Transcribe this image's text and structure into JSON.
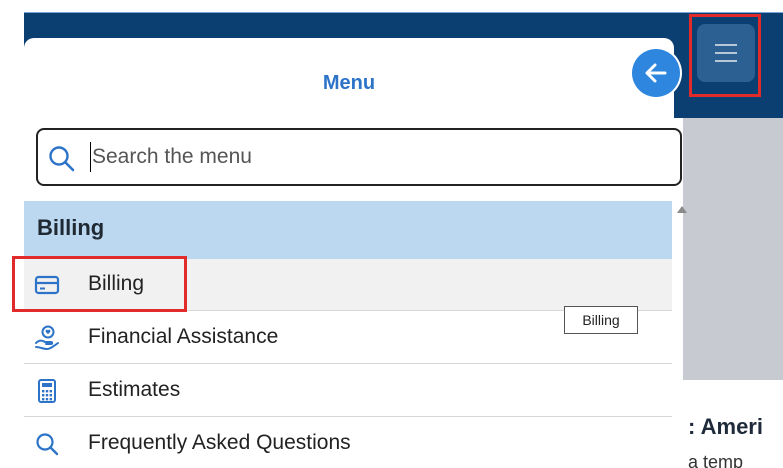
{
  "menu": {
    "title": "Menu",
    "search_placeholder": "Search the menu",
    "section_title": "Billing",
    "items": [
      {
        "label": "Billing",
        "icon": "credit-card-icon",
        "selected": true
      },
      {
        "label": "Financial Assistance",
        "icon": "hand-heart-icon",
        "selected": false
      },
      {
        "label": "Estimates",
        "icon": "calculator-icon",
        "selected": false
      },
      {
        "label": "Frequently Asked Questions",
        "icon": "search-icon",
        "selected": false
      }
    ]
  },
  "tooltip": {
    "text": "Billing"
  },
  "background": {
    "partial_heading": ": Ameri",
    "partial_text": "a temp"
  },
  "colors": {
    "accent": "#2d74c8",
    "header_bg": "#0b3f72",
    "section_bg": "#bcd8f0",
    "highlight": "#e12b2b"
  }
}
